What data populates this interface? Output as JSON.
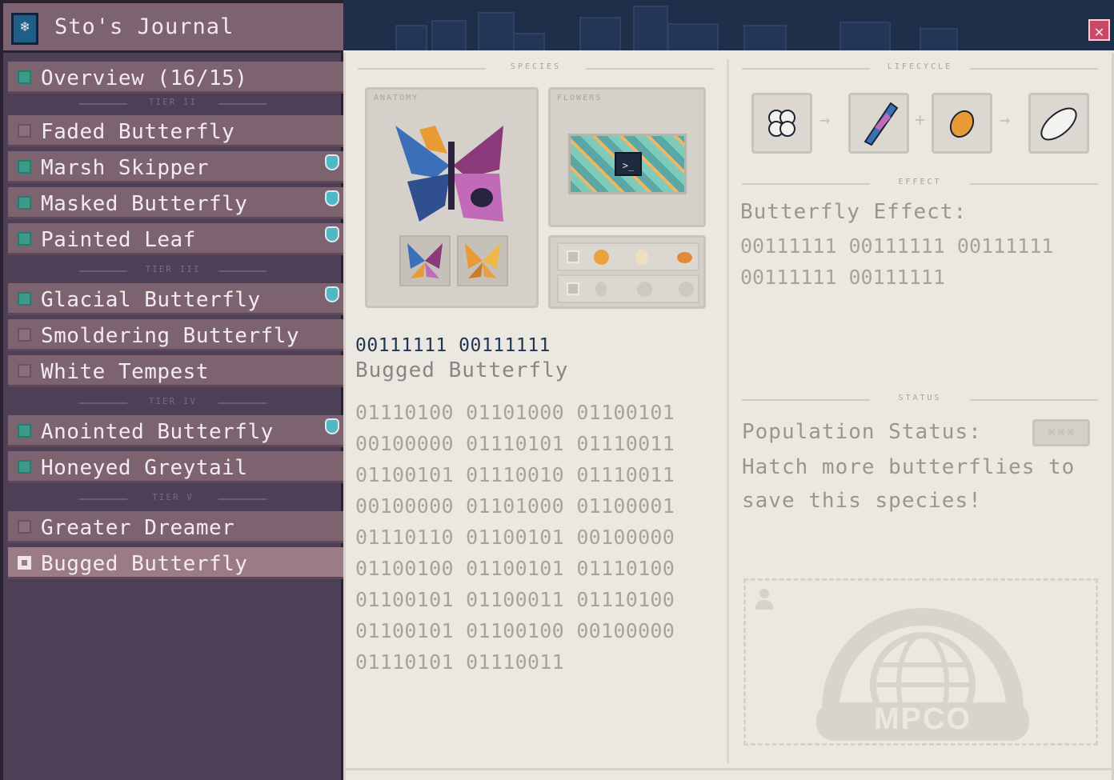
{
  "window": {
    "title": "Sto's Journal",
    "close_glyph": "✕"
  },
  "sidebar": {
    "overview": {
      "label": "Overview (16/15)",
      "state": "on"
    },
    "tiers": [
      {
        "label": "TIER II",
        "items": [
          {
            "label": "Faded Butterfly",
            "state": "off",
            "gem": false
          },
          {
            "label": "Marsh Skipper",
            "state": "on",
            "gem": true
          },
          {
            "label": "Masked Butterfly",
            "state": "on",
            "gem": true
          },
          {
            "label": "Painted Leaf",
            "state": "on",
            "gem": true
          }
        ]
      },
      {
        "label": "TIER III",
        "items": [
          {
            "label": "Glacial Butterfly",
            "state": "on",
            "gem": true
          },
          {
            "label": "Smoldering Butterfly",
            "state": "off",
            "gem": false
          },
          {
            "label": "White Tempest",
            "state": "off",
            "gem": false
          }
        ]
      },
      {
        "label": "TIER IV",
        "items": [
          {
            "label": "Anointed Butterfly",
            "state": "on",
            "gem": true
          },
          {
            "label": "Honeyed Greytail",
            "state": "on",
            "gem": false
          }
        ]
      },
      {
        "label": "TIER V",
        "items": [
          {
            "label": "Greater Dreamer",
            "state": "off",
            "gem": false
          },
          {
            "label": "Bugged Butterfly",
            "state": "selected",
            "gem": false
          }
        ]
      }
    ]
  },
  "species": {
    "section_label": "SPECIES",
    "anatomy_label": "ANATOMY",
    "flowers_label": "FLOWERS",
    "scientific_name": "00111111 00111111",
    "common_name": "Bugged Butterfly",
    "description_lines": [
      "01110100 01101000 01100101",
      "00100000 01110101 01110011",
      "01100101 01110010 01110011",
      "00100000 01101000 01100001",
      "01110110 01100101 00100000",
      "01100100 01100101 01110100",
      "01100101 01100011 01110100",
      "01100101 01100100 00100000",
      "01110101 01110011"
    ],
    "terminal_glyph": ">_",
    "conditions": {
      "row1_badge": "■",
      "row2_badge": "C",
      "colors": {
        "sun": "#e9a33c",
        "moon": "#efe0bd",
        "sunset": "#e08a3a",
        "faded": "#cdc8c0"
      }
    },
    "colors": {
      "wing_blue": "#3b6fb8",
      "wing_orange": "#e89a35",
      "wing_pink": "#c06ab8",
      "wing_dark": "#2a2340"
    }
  },
  "lifecycle": {
    "section_label": "LIFECYCLE",
    "stages": [
      "egg-cluster-icon",
      "caterpillar-icon",
      "chrysalis-icon",
      "cocoon-icon"
    ],
    "plus": "+"
  },
  "effect": {
    "section_label": "EFFECT",
    "title": "Butterfly Effect:",
    "lines": [
      "00111111 00111111 00111111",
      "00111111 00111111"
    ]
  },
  "status": {
    "section_label": "STATUS",
    "title": "Population Status:",
    "badge": "※※※",
    "message_lines": [
      "Hatch more butterflies to",
      "save this species!"
    ]
  },
  "stamp": {
    "text": "MPCO"
  }
}
